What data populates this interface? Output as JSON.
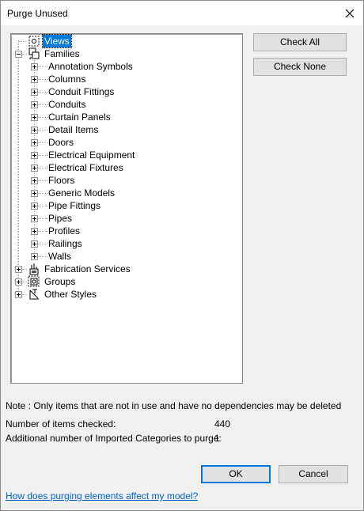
{
  "window": {
    "title": "Purge Unused"
  },
  "tree": {
    "root_items": [
      {
        "label": "Views",
        "icon": "views-icon",
        "selected": true
      },
      {
        "label": "Families",
        "icon": "families-icon",
        "expanded": true,
        "children": [
          "Annotation Symbols",
          "Columns",
          "Conduit Fittings",
          "Conduits",
          "Curtain Panels",
          "Detail Items",
          "Doors",
          "Electrical Equipment",
          "Electrical Fixtures",
          "Floors",
          "Generic Models",
          "Pipe Fittings",
          "Pipes",
          "Profiles",
          "Railings",
          "Walls"
        ]
      },
      {
        "label": "Fabrication Services",
        "icon": "fabrication-icon"
      },
      {
        "label": "Groups",
        "icon": "groups-icon"
      },
      {
        "label": "Other Styles",
        "icon": "styles-icon"
      }
    ]
  },
  "buttons": {
    "check_all": "Check All",
    "check_none": "Check None",
    "ok": "OK",
    "cancel": "Cancel"
  },
  "note": "Note : Only items that are not in use and have no dependencies may be deleted",
  "stats": {
    "items_checked_label": "Number of items checked:",
    "items_checked_value": "440",
    "imported_label": "Additional number of Imported Categories to purge:",
    "imported_value": "1"
  },
  "help_link": "How does purging elements affect my model?"
}
